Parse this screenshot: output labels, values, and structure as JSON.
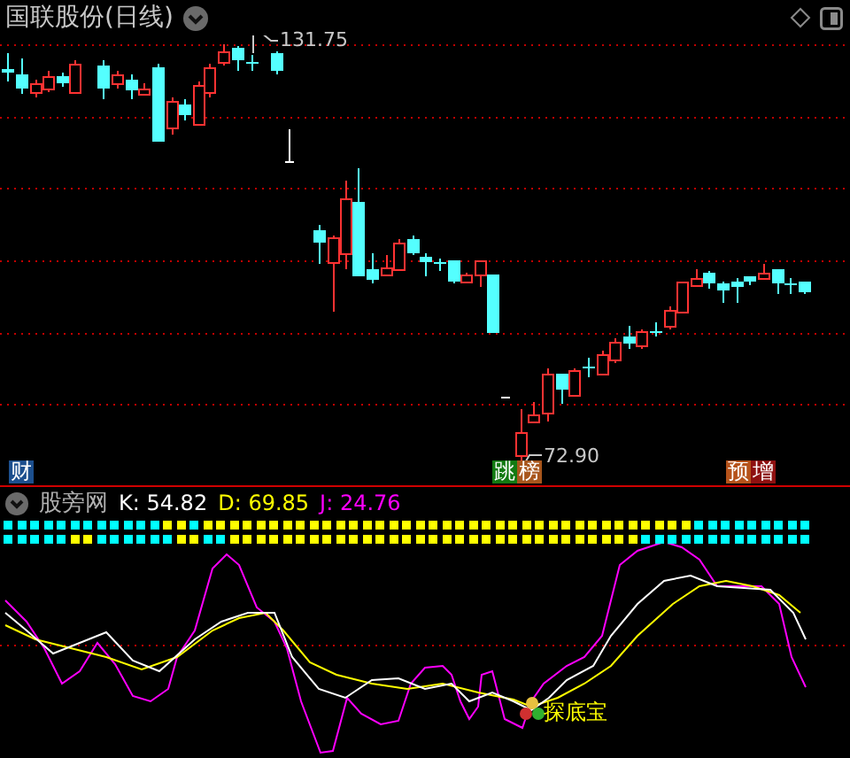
{
  "chart": {
    "title": "国联股份(日线)",
    "high_label": "131.75",
    "low_label": "72.90",
    "markers": [
      {
        "chars": [
          {
            "text": "财",
            "color": "#1c4f8e"
          }
        ]
      },
      {
        "chars": [
          {
            "text": "跳",
            "color": "#127a12"
          },
          {
            "text": "榜",
            "color": "#a8561c"
          }
        ]
      },
      {
        "chars": [
          {
            "text": "预",
            "color": "#b5521a"
          },
          {
            "text": "增",
            "color": "#8e1010"
          }
        ]
      }
    ]
  },
  "indicator": {
    "name": "股旁网",
    "values": [
      {
        "label": "K: 54.82",
        "color": "#ffffff"
      },
      {
        "label": "D: 69.85",
        "color": "#ffff00"
      },
      {
        "label": "J: 24.76",
        "color": "#ff00ff"
      }
    ],
    "signal_rows": [
      {
        "cells": [
          {
            "color": "#00ffff"
          },
          {
            "color": "#00ffff"
          },
          {
            "color": "#00ffff"
          },
          {
            "color": "#00ffff"
          },
          {
            "color": "#00ffff"
          },
          {
            "color": "#00ffff"
          },
          {
            "color": "#00ffff"
          },
          {
            "color": "#00ffff"
          },
          {
            "color": "#00ffff"
          },
          {
            "color": "#00ffff"
          },
          {
            "color": "#00ffff"
          },
          {
            "color": "#00ffff"
          },
          {
            "color": "#ffff00"
          },
          {
            "color": "#ffff00"
          },
          {
            "color": "#00ffff"
          },
          {
            "color": "#ffff00"
          },
          {
            "color": "#ffff00"
          },
          {
            "color": "#ffff00"
          },
          {
            "color": "#ffff00"
          },
          {
            "color": "#ffff00"
          },
          {
            "color": "#ffff00"
          },
          {
            "color": "#ffff00"
          },
          {
            "color": "#ffff00"
          },
          {
            "color": "#ffff00"
          },
          {
            "color": "#ffff00"
          },
          {
            "color": "#ffff00"
          },
          {
            "color": "#ffff00"
          },
          {
            "color": "#ffff00"
          },
          {
            "color": "#ffff00"
          },
          {
            "color": "#ffff00"
          },
          {
            "color": "#ffff00"
          },
          {
            "color": "#ffff00"
          },
          {
            "color": "#ffff00"
          },
          {
            "color": "#ffff00"
          },
          {
            "color": "#ffff00"
          },
          {
            "color": "#ffff00"
          },
          {
            "color": "#ffff00"
          },
          {
            "color": "#ffff00"
          },
          {
            "color": "#ffff00"
          },
          {
            "color": "#ffff00"
          },
          {
            "color": "#ffff00"
          },
          {
            "color": "#ffff00"
          },
          {
            "color": "#ffff00"
          },
          {
            "color": "#ffff00"
          },
          {
            "color": "#ffff00"
          },
          {
            "color": "#ffff00"
          },
          {
            "color": "#ffff00"
          },
          {
            "color": "#ffff00"
          },
          {
            "color": "#ffff00"
          },
          {
            "color": "#ffff00"
          },
          {
            "color": "#ffff00"
          },
          {
            "color": "#ffff00"
          },
          {
            "color": "#00ffff"
          },
          {
            "color": "#00ffff"
          },
          {
            "color": "#00ffff"
          },
          {
            "color": "#00ffff"
          },
          {
            "color": "#00ffff"
          },
          {
            "color": "#00ffff"
          },
          {
            "color": "#00ffff"
          },
          {
            "color": "#00ffff"
          },
          {
            "color": "#00ffff"
          }
        ]
      },
      {
        "cells": [
          {
            "color": "#00ffff"
          },
          {
            "color": "#00ffff"
          },
          {
            "color": "#00ffff"
          },
          {
            "color": "#00ffff"
          },
          {
            "color": "#00ffff"
          },
          {
            "color": "#ffff00"
          },
          {
            "color": "#ffff00"
          },
          {
            "color": "#00ffff"
          },
          {
            "color": "#00ffff"
          },
          {
            "color": "#00ffff"
          },
          {
            "color": "#00ffff"
          },
          {
            "color": "#00ffff"
          },
          {
            "color": "#00ffff"
          },
          {
            "color": "#ffff00"
          },
          {
            "color": "#ffff00"
          },
          {
            "color": "#00ffff"
          },
          {
            "color": "#00ffff"
          },
          {
            "color": "#ffff00"
          },
          {
            "color": "#ffff00"
          },
          {
            "color": "#ffff00"
          },
          {
            "color": "#ffff00"
          },
          {
            "color": "#ffff00"
          },
          {
            "color": "#ffff00"
          },
          {
            "color": "#ffff00"
          },
          {
            "color": "#ffff00"
          },
          {
            "color": "#ffff00"
          },
          {
            "color": "#ffff00"
          },
          {
            "color": "#ffff00"
          },
          {
            "color": "#ffff00"
          },
          {
            "color": "#ffff00"
          },
          {
            "color": "#ffff00"
          },
          {
            "color": "#ffff00"
          },
          {
            "color": "#ffff00"
          },
          {
            "color": "#ffff00"
          },
          {
            "color": "#ffff00"
          },
          {
            "color": "#ffff00"
          },
          {
            "color": "#ffff00"
          },
          {
            "color": "#ffff00"
          },
          {
            "color": "#ffff00"
          },
          {
            "color": "#ffff00"
          },
          {
            "color": "#ffff00"
          },
          {
            "color": "#ffff00"
          },
          {
            "color": "#ffff00"
          },
          {
            "color": "#ffff00"
          },
          {
            "color": "#ffff00"
          },
          {
            "color": "#ffff00"
          },
          {
            "color": "#ffff00"
          },
          {
            "color": "#ffff00"
          },
          {
            "color": "#00ffff"
          },
          {
            "color": "#00ffff"
          },
          {
            "color": "#00ffff"
          },
          {
            "color": "#00ffff"
          },
          {
            "color": "#00ffff"
          },
          {
            "color": "#00ffff"
          },
          {
            "color": "#00ffff"
          },
          {
            "color": "#00ffff"
          },
          {
            "color": "#00ffff"
          },
          {
            "color": "#00ffff"
          },
          {
            "color": "#00ffff"
          },
          {
            "color": "#00ffff"
          },
          {
            "color": "#00ffff"
          }
        ]
      }
    ],
    "signal_label": "探底宝"
  }
}
